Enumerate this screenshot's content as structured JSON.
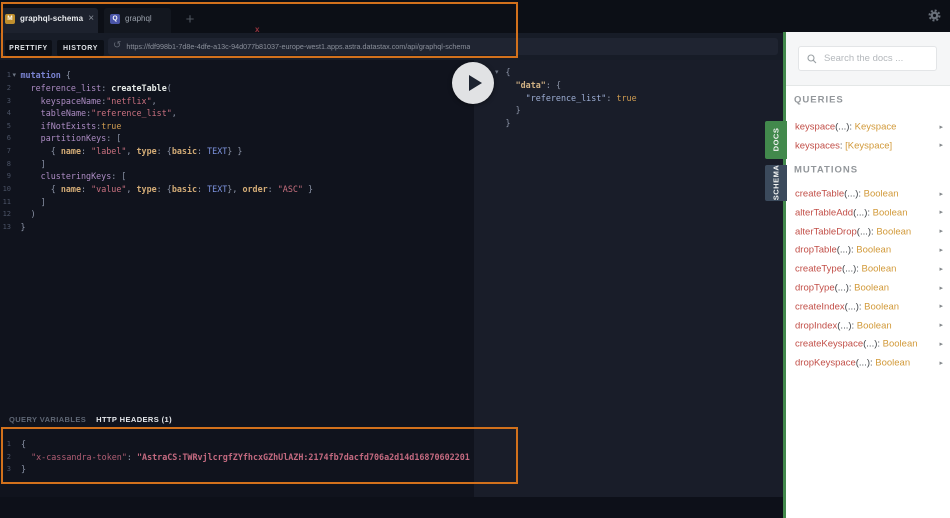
{
  "topbar": {
    "tabs": [
      {
        "badge": "M",
        "label": "graphql-schema",
        "close": "×",
        "active": true
      },
      {
        "badge": "Q",
        "label": "graphql",
        "active": false
      }
    ],
    "add_button": "+",
    "gear_icon": "⚙"
  },
  "toolbar": {
    "prettify_label": "PRETTIFY",
    "history_label": "HISTORY",
    "url_icon": "↺",
    "url": "https://fdf998b1-7d8e-4dfe-a13c-94d077b81037-europe-west1.apps.astra.datastax.com/api/graphql-schema"
  },
  "query_editor": {
    "fold_icon": "▾",
    "lines": [
      [
        [
          "kw",
          "mutation"
        ],
        [
          "p",
          " {"
        ]
      ],
      [
        [
          "p",
          "  "
        ],
        [
          "attr",
          "reference_list"
        ],
        [
          "p",
          ": "
        ],
        [
          "field",
          "createTable"
        ],
        [
          "p",
          "("
        ]
      ],
      [
        [
          "p",
          "    "
        ],
        [
          "attr",
          "keyspaceName"
        ],
        [
          "p",
          ":"
        ],
        [
          "str",
          "\"netflix\""
        ],
        [
          "p",
          ","
        ]
      ],
      [
        [
          "p",
          "    "
        ],
        [
          "attr",
          "tableName"
        ],
        [
          "p",
          ":"
        ],
        [
          "str",
          "\"reference_list\""
        ],
        [
          "p",
          ","
        ]
      ],
      [
        [
          "p",
          "    "
        ],
        [
          "attr",
          "ifNotExists"
        ],
        [
          "p",
          ":"
        ],
        [
          "bool",
          "true"
        ]
      ],
      [
        [
          "p",
          "    "
        ],
        [
          "attr",
          "partitionKeys"
        ],
        [
          "p",
          ": ["
        ]
      ],
      [
        [
          "p",
          "      { "
        ],
        [
          "okey",
          "name"
        ],
        [
          "p",
          ": "
        ],
        [
          "str",
          "\"label\""
        ],
        [
          "p",
          ", "
        ],
        [
          "okey",
          "type"
        ],
        [
          "p",
          ": {"
        ],
        [
          "okey",
          "basic"
        ],
        [
          "p",
          ": "
        ],
        [
          "enum",
          "TEXT"
        ],
        [
          "p",
          "} }"
        ]
      ],
      [
        [
          "p",
          "    ]"
        ]
      ],
      [
        [
          "p",
          "    "
        ],
        [
          "attr",
          "clusteringKeys"
        ],
        [
          "p",
          ": ["
        ]
      ],
      [
        [
          "p",
          "      { "
        ],
        [
          "okey",
          "name"
        ],
        [
          "p",
          ": "
        ],
        [
          "str",
          "\"value\""
        ],
        [
          "p",
          ", "
        ],
        [
          "okey",
          "type"
        ],
        [
          "p",
          ": {"
        ],
        [
          "okey",
          "basic"
        ],
        [
          "p",
          ": "
        ],
        [
          "enum",
          "TEXT"
        ],
        [
          "p",
          "}, "
        ],
        [
          "okey",
          "order"
        ],
        [
          "p",
          ": "
        ],
        [
          "str",
          "\"ASC\""
        ],
        [
          "p",
          " }"
        ]
      ],
      [
        [
          "p",
          "    ]"
        ]
      ],
      [
        [
          "p",
          "  )"
        ]
      ],
      [
        [
          "p",
          "}"
        ]
      ]
    ]
  },
  "result_viewer": {
    "fold_icon": "▾",
    "lines": [
      [
        [
          "p",
          "{"
        ]
      ],
      [
        [
          "p",
          "  "
        ],
        [
          "rkey",
          "\"data\""
        ],
        [
          "p",
          ": {"
        ]
      ],
      [
        [
          "p",
          "    "
        ],
        [
          "rref",
          "\"reference_list\""
        ],
        [
          "p",
          ": "
        ],
        [
          "bool",
          "true"
        ]
      ],
      [
        [
          "p",
          "  }"
        ]
      ],
      [
        [
          "p",
          "}"
        ]
      ]
    ]
  },
  "variables_panel": {
    "tabs": [
      {
        "label": "QUERY VARIABLES",
        "active": false
      },
      {
        "label": "HTTP HEADERS (1)",
        "active": true
      }
    ],
    "lines": [
      [
        [
          "p",
          "{"
        ]
      ],
      [
        [
          "p",
          "  "
        ],
        [
          "hkey",
          "\"x-cassandra-token\""
        ],
        [
          "p",
          ": "
        ],
        [
          "hval",
          "\"AstraCS:TWRvjlcrgfZYfhcxGZhUlAZH:2174fb7dacfd706a2d14d16870602201"
        ]
      ],
      [
        [
          "p",
          "}"
        ]
      ]
    ]
  },
  "docs_panel": {
    "search_placeholder": "Search the docs ...",
    "item_arrow": "▸",
    "docs_tab_label": "DOCS",
    "schema_tab_label": "SCHEMA",
    "sections": [
      {
        "title": "QUERIES",
        "items": [
          {
            "name": "keyspace",
            "args": "(...)",
            "sep": ": ",
            "type": "Keyspace"
          },
          {
            "name": "keyspaces",
            "args": "",
            "sep": ": ",
            "type": "[Keyspace]"
          }
        ]
      },
      {
        "title": "MUTATIONS",
        "items": [
          {
            "name": "createTable",
            "args": "(...)",
            "sep": ": ",
            "type": "Boolean"
          },
          {
            "name": "alterTableAdd",
            "args": "(...)",
            "sep": ": ",
            "type": "Boolean"
          },
          {
            "name": "alterTableDrop",
            "args": "(...)",
            "sep": ": ",
            "type": "Boolean"
          },
          {
            "name": "dropTable",
            "args": "(...)",
            "sep": ": ",
            "type": "Boolean"
          },
          {
            "name": "createType",
            "args": "(...)",
            "sep": ": ",
            "type": "Boolean"
          },
          {
            "name": "dropType",
            "args": "(...)",
            "sep": ": ",
            "type": "Boolean"
          },
          {
            "name": "createIndex",
            "args": "(...)",
            "sep": ": ",
            "type": "Boolean"
          },
          {
            "name": "dropIndex",
            "args": "(...)",
            "sep": ": ",
            "type": "Boolean"
          },
          {
            "name": "createKeyspace",
            "args": "(...)",
            "sep": ": ",
            "type": "Boolean"
          },
          {
            "name": "dropKeyspace",
            "args": "(...)",
            "sep": ": ",
            "type": "Boolean"
          }
        ]
      }
    ]
  },
  "annotations": {
    "color": "#d2711c",
    "marker": "x"
  },
  "colors": {
    "annotation_orange": "#d2711c",
    "docs_green": "#42894c",
    "schema_tab": "#3b4a5c",
    "editor_bg": "#10131d",
    "result_bg": "#191d29",
    "tab_badge_m": "#c08f2d",
    "tab_badge_q": "#4a55a8"
  }
}
